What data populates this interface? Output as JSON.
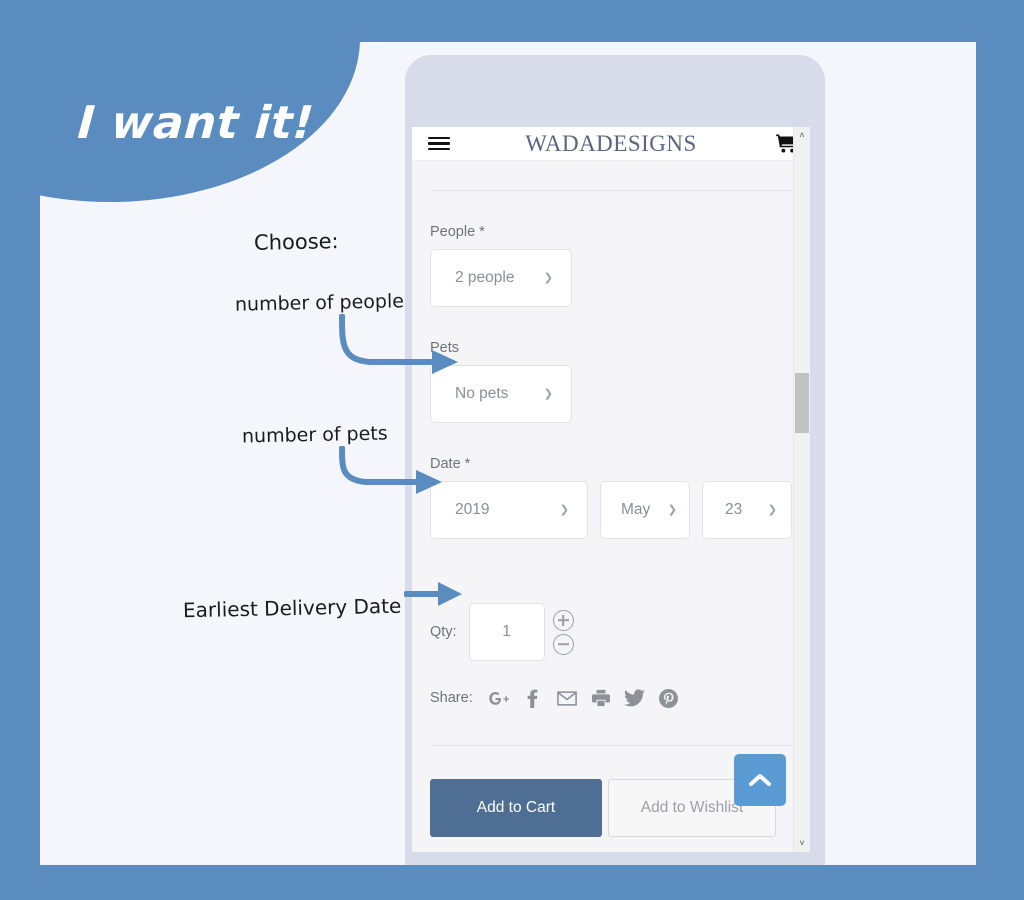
{
  "theme": {
    "canvas_blue": "#5a8cc0",
    "panel_bg": "#f4f6fb",
    "phone_frame": "#d7dbea",
    "screen_bg": "#f5f5f7",
    "brand_color": "#5a6582",
    "primary_button": "#4e6e94",
    "fab_blue": "#5a9bd4",
    "annotation_arrow": "#5a8cc0"
  },
  "callout": {
    "text": "I want it!"
  },
  "annotations": [
    {
      "id": "choose",
      "text": "Choose:"
    },
    {
      "id": "number-of-people",
      "text": "number of people"
    },
    {
      "id": "number-of-pets",
      "text": "number of pets"
    },
    {
      "id": "earliest-delivery-date",
      "text": "Earliest Delivery Date"
    }
  ],
  "phone": {
    "header": {
      "menu_icon": "hamburger-menu-icon",
      "brand": "WADADESIGNS",
      "cart_icon": "shopping-cart-icon"
    },
    "form": {
      "people": {
        "label": "People *",
        "value": "2 people",
        "chevron": "chevron-down-icon"
      },
      "pets": {
        "label": "Pets",
        "value": "No pets",
        "chevron": "chevron-down-icon"
      },
      "date": {
        "label": "Date *",
        "year": "2019",
        "month": "May",
        "day": "23",
        "chevron": "chevron-down-icon"
      },
      "qty": {
        "label": "Qty:",
        "value": "1",
        "increment_icon": "plus-circle-icon",
        "decrement_icon": "minus-circle-icon"
      }
    },
    "share": {
      "label": "Share:",
      "icons": [
        {
          "name": "google-plus-icon",
          "glyph": "G+"
        },
        {
          "name": "facebook-icon",
          "glyph": "f"
        },
        {
          "name": "email-icon",
          "glyph": "✉"
        },
        {
          "name": "print-icon",
          "glyph": "⎙"
        },
        {
          "name": "twitter-icon",
          "glyph": "ᴠ"
        },
        {
          "name": "pinterest-icon",
          "glyph": "Ⓟ"
        }
      ]
    },
    "actions": {
      "add_to_cart": "Add to Cart",
      "add_to_wishlist": "Add to Wishlist"
    },
    "scroll_to_top": {
      "icon": "chevron-up-icon"
    },
    "scrollbar": {
      "up_arrow": "˄",
      "down_arrow": "˅"
    }
  }
}
